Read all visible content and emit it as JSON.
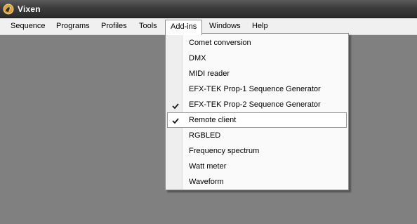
{
  "window": {
    "title": "Vixen",
    "icon": "vixen-logo-icon"
  },
  "menubar": {
    "items": [
      {
        "label": "Sequence"
      },
      {
        "label": "Programs"
      },
      {
        "label": "Profiles"
      },
      {
        "label": "Tools"
      },
      {
        "label": "Add-ins",
        "open": true
      },
      {
        "label": "Windows"
      },
      {
        "label": "Help"
      }
    ]
  },
  "addins_menu": {
    "items": [
      {
        "label": "Comet conversion",
        "checked": false
      },
      {
        "label": "DMX",
        "checked": false
      },
      {
        "label": "MIDI reader",
        "checked": false
      },
      {
        "label": "EFX-TEK Prop-1 Sequence Generator",
        "checked": false
      },
      {
        "label": "EFX-TEK Prop-2 Sequence Generator",
        "checked": true
      },
      {
        "label": "Remote client",
        "checked": true,
        "highlighted": true
      },
      {
        "label": "RGBLED",
        "checked": false
      },
      {
        "label": "Frequency spectrum",
        "checked": false
      },
      {
        "label": "Watt meter",
        "checked": false
      },
      {
        "label": "Waveform",
        "checked": false
      }
    ]
  },
  "colors": {
    "workspace": "#808080",
    "titlebar": "#3c3c3c",
    "menubar": "#f0f0f0",
    "dropdown": "#fafafa"
  }
}
